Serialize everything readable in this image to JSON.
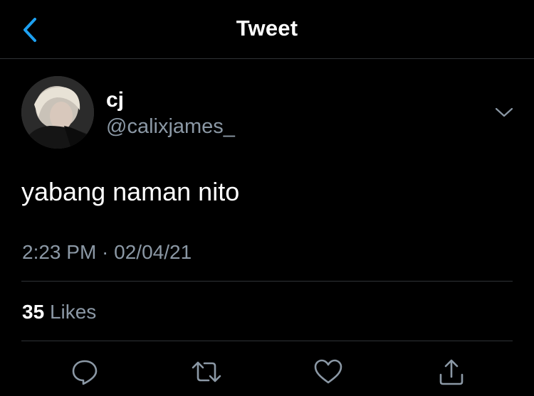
{
  "header": {
    "title": "Tweet"
  },
  "tweet": {
    "author": {
      "display_name": "cj",
      "handle": "@calixjames_"
    },
    "text": "yabang naman nito",
    "timestamp": "2:23 PM · 02/04/21",
    "likes_count": "35",
    "likes_label": "Likes"
  },
  "icons": {
    "back": "chevron-left-icon",
    "more": "chevron-down-icon",
    "reply": "reply-icon",
    "retweet": "retweet-icon",
    "like": "heart-icon",
    "share": "share-icon"
  },
  "colors": {
    "background": "#000000",
    "accent": "#1da1f2",
    "secondary_text": "#8b98a5",
    "divider": "#2f3336"
  }
}
